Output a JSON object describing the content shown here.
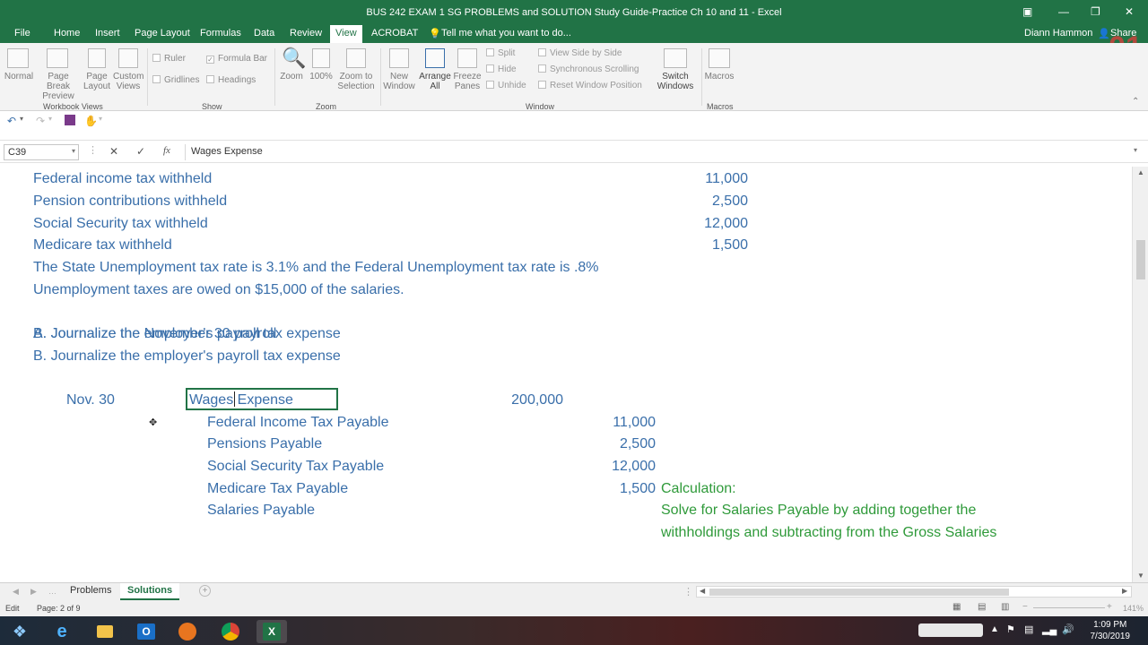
{
  "window": {
    "title": "BUS 242 EXAM 1 SG PROBLEMS and SOLUTION Study Guide-Practice  Ch 10 and 11  -  Excel",
    "user": "Diann Hammon",
    "share": "Share",
    "overlay_badge": "01"
  },
  "menu": {
    "items": [
      "File",
      "Home",
      "Insert",
      "Page Layout",
      "Formulas",
      "Data",
      "Review",
      "View",
      "ACROBAT"
    ],
    "active": "View",
    "tell_me": "Tell me what you want to do..."
  },
  "ribbon": {
    "workbook_views": {
      "group": "Workbook Views",
      "buttons": [
        "Normal",
        "Page Break Preview",
        "Page Layout",
        "Custom Views"
      ]
    },
    "show": {
      "group": "Show",
      "ruler": "Ruler",
      "formula_bar": "Formula Bar",
      "gridlines": "Gridlines",
      "headings": "Headings"
    },
    "zoom": {
      "group": "Zoom",
      "zoom": "Zoom",
      "hundred": "100%",
      "zoom_selection": "Zoom to Selection"
    },
    "window": {
      "group": "Window",
      "new_window": "New Window",
      "arrange_all": "Arrange All",
      "freeze_panes": "Freeze Panes",
      "split": "Split",
      "hide": "Hide",
      "unhide": "Unhide",
      "view_side": "View Side by Side",
      "sync_scroll": "Synchronous Scrolling",
      "reset_pos": "Reset Window Position",
      "switch_windows": "Switch Windows"
    },
    "macros": {
      "group": "Macros",
      "macros": "Macros"
    }
  },
  "formula_bar": {
    "name_box": "C39",
    "cancel": "✕",
    "enter": "✓",
    "fx": "fx",
    "content": "Wages Expense"
  },
  "sheet": {
    "lines": [
      {
        "label": "Federal income tax withheld",
        "value": "11,000"
      },
      {
        "label": "Pension contributions withheld",
        "value": "2,500"
      },
      {
        "label": "Social Security tax withheld",
        "value": "12,000"
      },
      {
        "label": "Medicare tax withheld",
        "value": "1,500"
      }
    ],
    "note1": "The State Unemployment tax rate is 3.1% and the Federal Unemployment tax rate is .8%",
    "note2": "Unemployment taxes are owed on $15,000 of the salaries.",
    "task_a": "A. Journalize the November 30 payroll",
    "task_b": "B. Journalize the employer's payroll tax expense",
    "journal": {
      "date": "Nov. 30",
      "debit_account": "Wages Expense",
      "debit_amount": "200,000",
      "credits": [
        {
          "account": "Federal Income Tax Payable",
          "amount": "11,000"
        },
        {
          "account": "Pensions Payable",
          "amount": "2,500"
        },
        {
          "account": "Social Security Tax Payable",
          "amount": "12,000"
        },
        {
          "account": "Medicare Tax Payable",
          "amount": "1,500"
        },
        {
          "account": "Salaries Payable",
          "amount": ""
        }
      ]
    },
    "calc_title": "Calculation:",
    "calc_line1": "Solve for Salaries Payable by adding together the",
    "calc_line2": "withholdings and subtracting from the Gross Salaries"
  },
  "tabs": {
    "items": [
      "Problems",
      "Solutions"
    ],
    "active": "Solutions"
  },
  "status": {
    "mode": "Edit",
    "page": "Page: 2 of 9",
    "zoom": "141%"
  },
  "taskbar": {
    "time": "1:09 PM",
    "date": "7/30/2019"
  },
  "colors": {
    "excel_green": "#217346",
    "cell_blue": "#3a6faa",
    "calc_green": "#2f9a3a"
  }
}
